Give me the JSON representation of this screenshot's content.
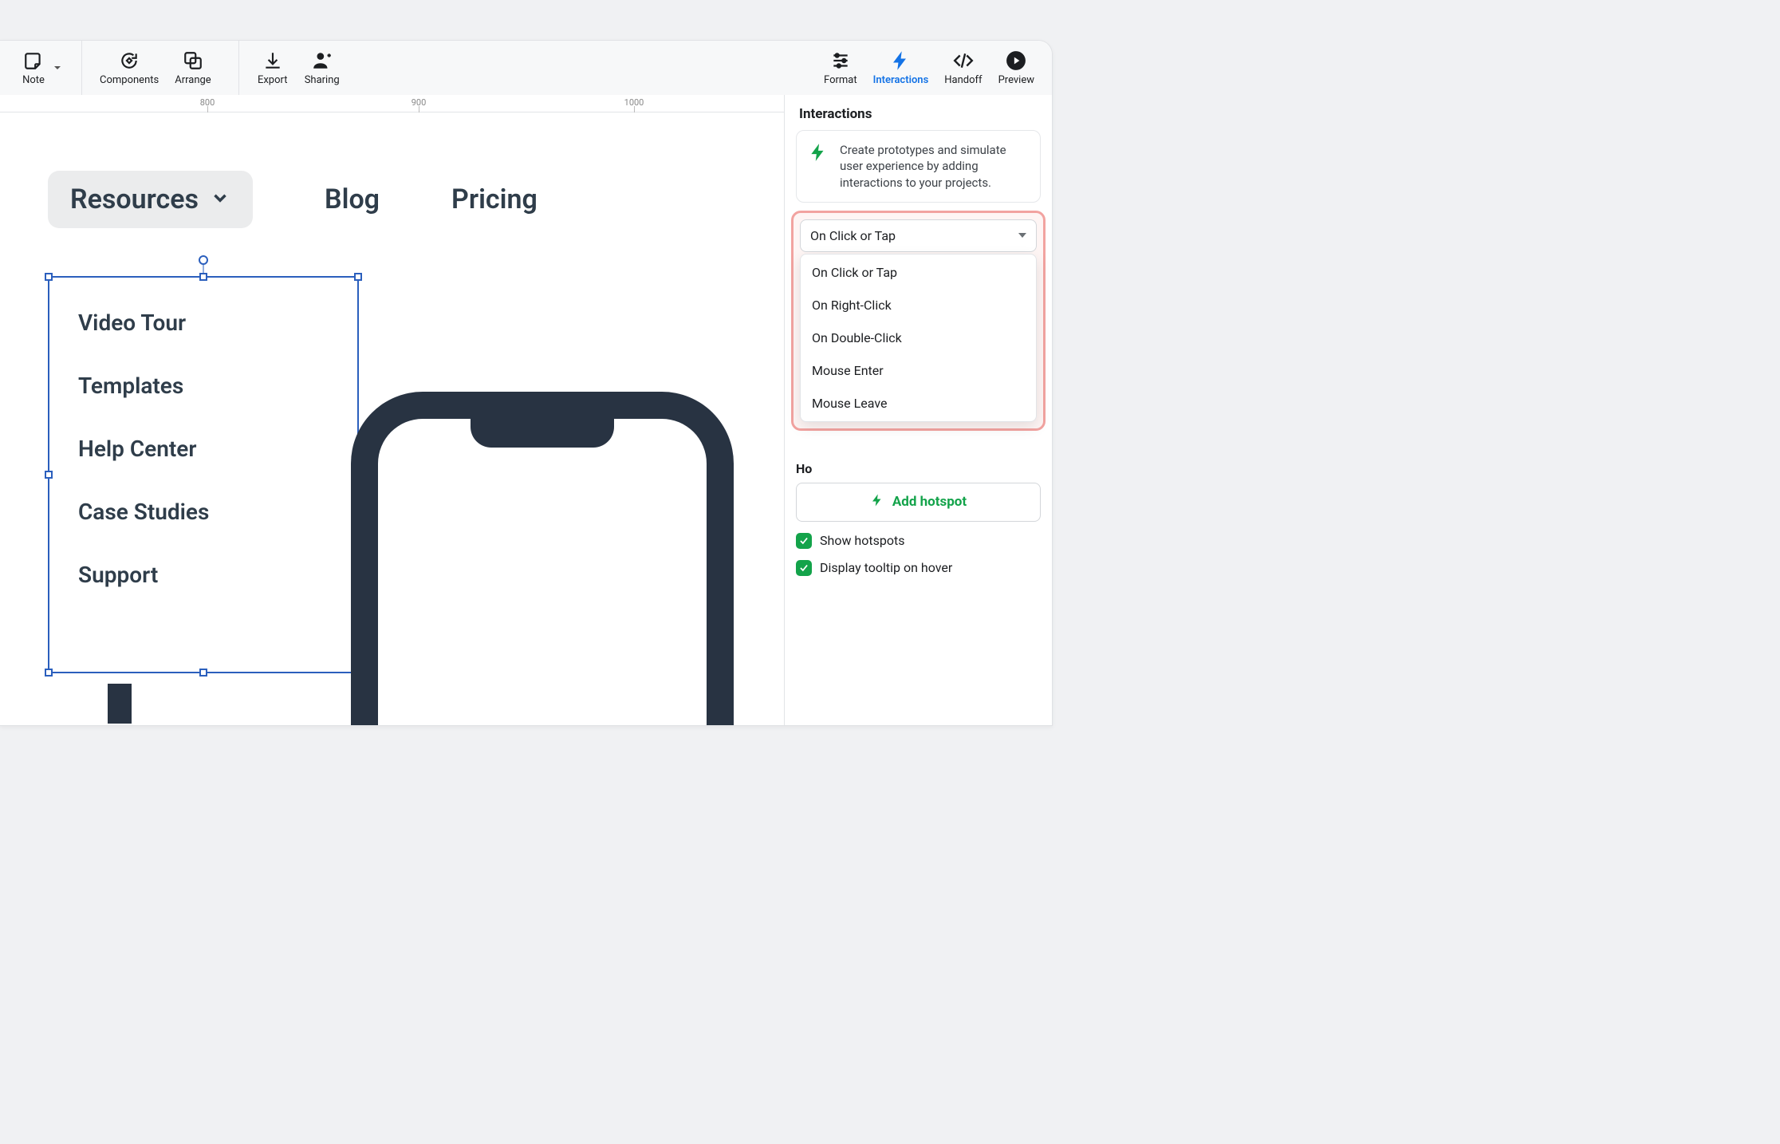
{
  "toolbar": {
    "note": "Note",
    "components": "Components",
    "arrange": "Arrange",
    "export": "Export",
    "sharing": "Sharing",
    "format": "Format",
    "interactions": "Interactions",
    "handoff": "Handoff",
    "preview": "Preview"
  },
  "ruler": {
    "marks": [
      "800",
      "900",
      "1000"
    ]
  },
  "canvas": {
    "resources_label": "Resources",
    "nav_blog": "Blog",
    "nav_pricing": "Pricing",
    "menu_items": [
      "Video Tour",
      "Templates",
      "Help Center",
      "Case Studies",
      "Support"
    ]
  },
  "panel": {
    "title": "Interactions",
    "info": "Create prototypes and simulate user experience by adding interactions to your projects.",
    "trigger_selected": "On Click or Tap",
    "trigger_options": [
      "On Click or Tap",
      "On Right-Click",
      "On Double-Click",
      "Mouse Enter",
      "Mouse Leave"
    ],
    "hotspot_header_truncated": "Ho",
    "add_hotspot": "Add hotspot",
    "show_hotspots": "Show hotspots",
    "display_tooltip": "Display tooltip on hover"
  }
}
